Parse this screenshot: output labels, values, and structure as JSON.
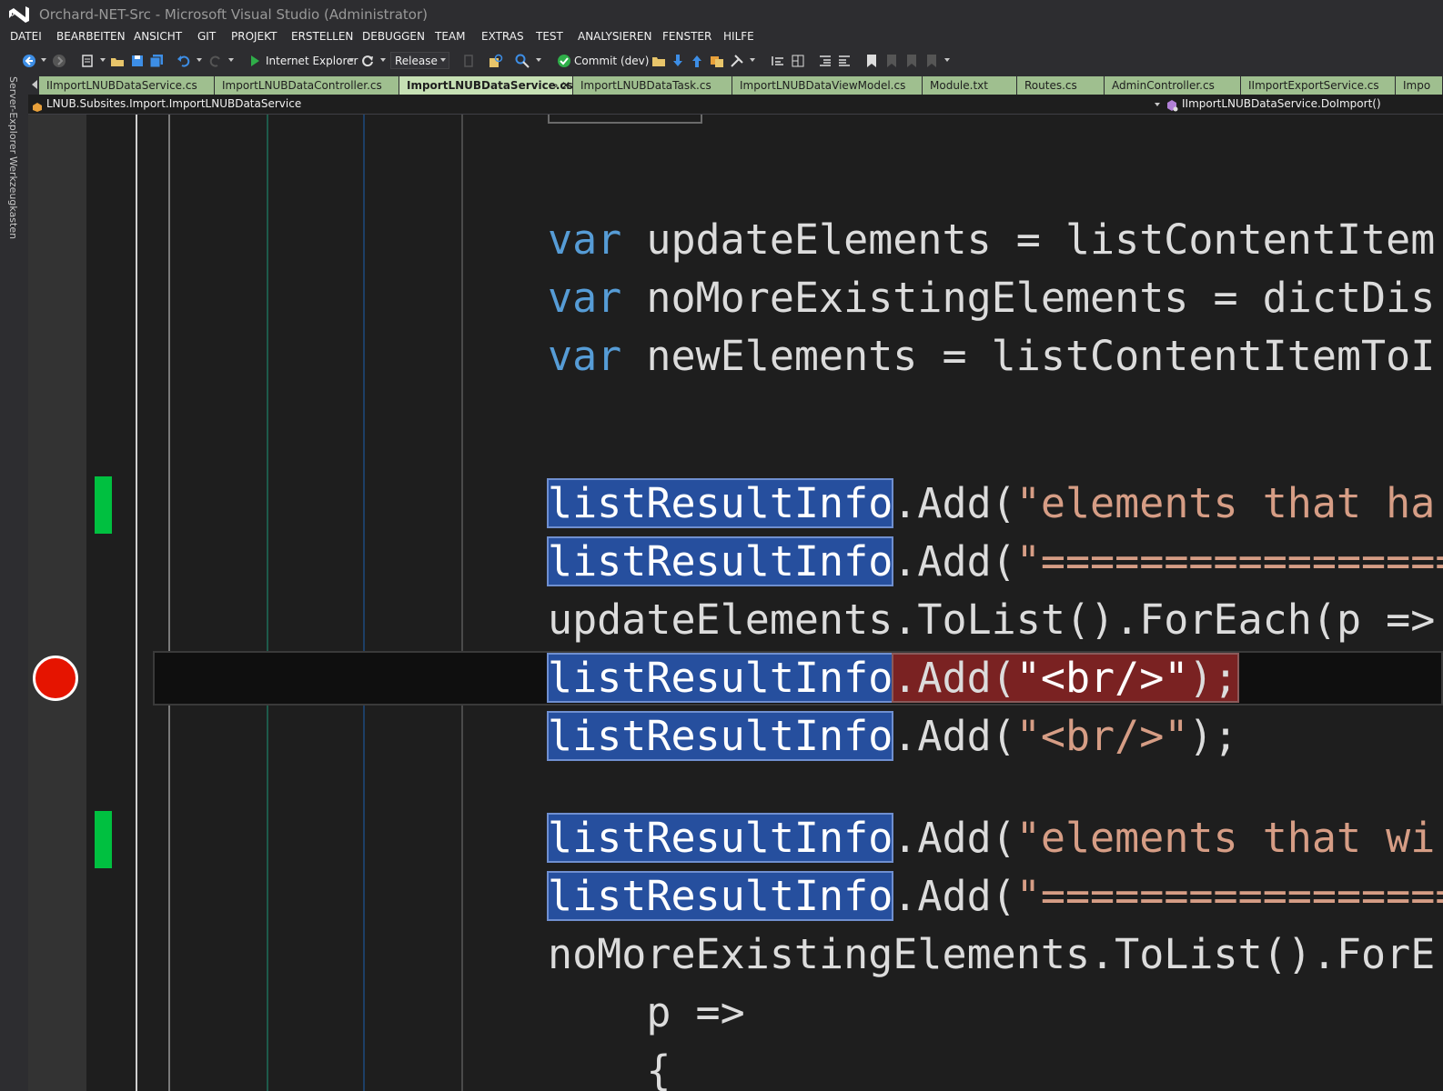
{
  "window": {
    "title": "Orchard-NET-Src - Microsoft Visual Studio (Administrator)"
  },
  "menu": [
    "DATEI",
    "BEARBEITEN",
    "ANSICHT",
    "GIT",
    "PROJEKT",
    "ERSTELLEN",
    "DEBUGGEN",
    "TEAM",
    "EXTRAS",
    "TEST",
    "ANALYSIEREN",
    "FENSTER",
    "HILFE"
  ],
  "toolbar": {
    "run_target": "Internet Explorer",
    "configuration": "Release",
    "commit_label": "Commit (dev)"
  },
  "side_tabs": [
    "Server-Explorer",
    "Werkzeugkasten"
  ],
  "doc_tabs": [
    {
      "label": "IImportLNUBDataService.cs",
      "active": false
    },
    {
      "label": "ImportLNUBDataController.cs",
      "active": false
    },
    {
      "label": "ImportLNUBDataService.cs",
      "active": true
    },
    {
      "label": "ImportLNUBDataTask.cs",
      "active": false
    },
    {
      "label": "ImportLNUBDataViewModel.cs",
      "active": false
    },
    {
      "label": "Module.txt",
      "active": false
    },
    {
      "label": "Routes.cs",
      "active": false
    },
    {
      "label": "AdminController.cs",
      "active": false
    },
    {
      "label": "IImportExportService.cs",
      "active": false
    },
    {
      "label": "Impo",
      "active": false
    }
  ],
  "navbar": {
    "type_path": "LNUB.Subsites.Import.ImportLNUBDataService",
    "member": "IImportLNUBDataService.DoImport()"
  },
  "code": {
    "keyword_var": "var",
    "line1_rest": " updateElements = listContentItem",
    "line2_rest": " noMoreExistingElements = dictDis",
    "line3_rest": " newElements = listContentItemToI",
    "ident": "listResultInfo",
    "add_open": ".Add(",
    "str_elements_that_ha": "\"elements that ha",
    "str_equals": "\"====================",
    "line_updates_foreach": "updateElements.ToList().ForEach(p =>",
    "bp_add": ".Add(",
    "str_br": "\"<br/>\"",
    "close": ");",
    "str_elements_that_wi": "\"elements that wi",
    "line_nomore_foreach": "noMoreExistingElements.ToList().ForE",
    "line_p_lambda": "    p =>",
    "line_brace": "    {"
  }
}
